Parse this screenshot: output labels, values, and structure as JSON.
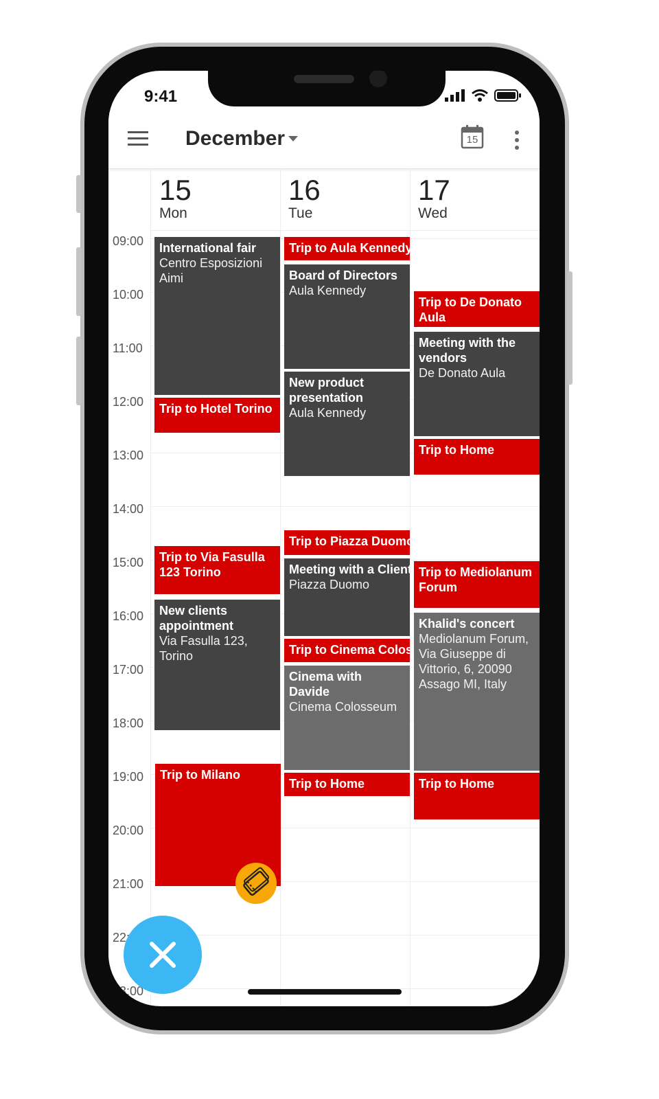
{
  "status_bar": {
    "time": "9:41"
  },
  "toolbar": {
    "month": "December",
    "today_number": "15"
  },
  "days": [
    {
      "number": "15",
      "name": "Mon"
    },
    {
      "number": "16",
      "name": "Tue"
    },
    {
      "number": "17",
      "name": "Wed"
    }
  ],
  "hours": [
    "09:00",
    "10:00",
    "11:00",
    "12:00",
    "13:00",
    "14:00",
    "15:00",
    "16:00",
    "17:00",
    "18:00",
    "19:00",
    "20:00",
    "21:00",
    "22:00",
    "23:00"
  ],
  "events": {
    "mon": [
      {
        "title": "International fair",
        "location": "Centro Esposizioni Aimi",
        "color": "dark"
      },
      {
        "title": "Trip to Hotel Torino",
        "location": "",
        "color": "red"
      },
      {
        "title": "Trip to Via Fasulla 123 Torino",
        "location": "",
        "color": "red"
      },
      {
        "title": "New clients appointment",
        "location": "Via Fasulla 123, Torino",
        "color": "dark"
      },
      {
        "title": "Trip to Milano",
        "location": "",
        "color": "red"
      }
    ],
    "tue": [
      {
        "title": "Trip to Aula Kennedy",
        "location": "",
        "color": "red"
      },
      {
        "title": "Board of Directors",
        "location": "Aula Kennedy",
        "color": "dark"
      },
      {
        "title": "New product presentation",
        "location": "Aula Kennedy",
        "color": "dark"
      },
      {
        "title": "Trip to Piazza Duomo",
        "location": "",
        "color": "red"
      },
      {
        "title": "Meeting with a Client",
        "location": "Piazza Duomo",
        "color": "dark"
      },
      {
        "title": "Trip to Cinema Colosseum",
        "location": "",
        "color": "red"
      },
      {
        "title": "Cinema with Davide",
        "location": "Cinema Colosseum",
        "color": "gray"
      },
      {
        "title": "Trip to Home",
        "location": "",
        "color": "red"
      }
    ],
    "wed": [
      {
        "title": "Trip to De Donato Aula",
        "location": "",
        "color": "red"
      },
      {
        "title": "Meeting with the vendors",
        "location": "De Donato Aula",
        "color": "dark"
      },
      {
        "title": "Trip to Home",
        "location": "",
        "color": "red"
      },
      {
        "title": "Trip to Mediolanum Forum",
        "location": "",
        "color": "red"
      },
      {
        "title": "Khalid's concert",
        "location": "Mediolanum Forum, Via Giuseppe di Vittorio, 6, 20090 Assago MI, Italy",
        "color": "gray"
      },
      {
        "title": "Trip to Home",
        "location": "",
        "color": "red"
      }
    ]
  },
  "colors": {
    "red": "#d50000",
    "dark": "#434343",
    "gray": "#6c6c6c",
    "fab": "#3db7f4",
    "ticket": "#f7a707"
  }
}
